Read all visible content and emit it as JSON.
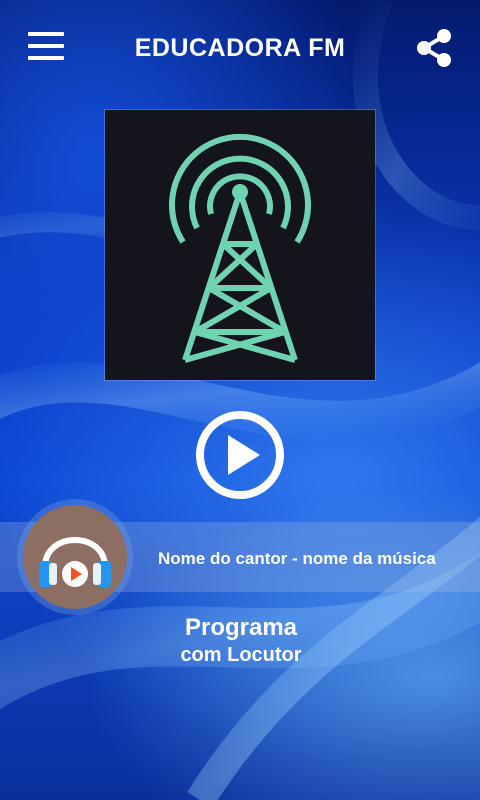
{
  "header": {
    "title": "EDUCADORA FM",
    "menu_icon": "hamburger-menu-icon",
    "share_icon": "share-icon"
  },
  "station_logo": {
    "icon": "radio-tower-icon",
    "color": "#6fd3b1"
  },
  "player": {
    "play_icon": "play-icon"
  },
  "now_playing": {
    "track": "Nome do cantor - nome da música",
    "avatar_icon": "headphones-play-icon"
  },
  "program": {
    "name": "Programa",
    "host": "com Locutor"
  },
  "colors": {
    "background": "#0d4ad6",
    "avatar_bg": "#8d6e63",
    "text": "#ffffff"
  }
}
